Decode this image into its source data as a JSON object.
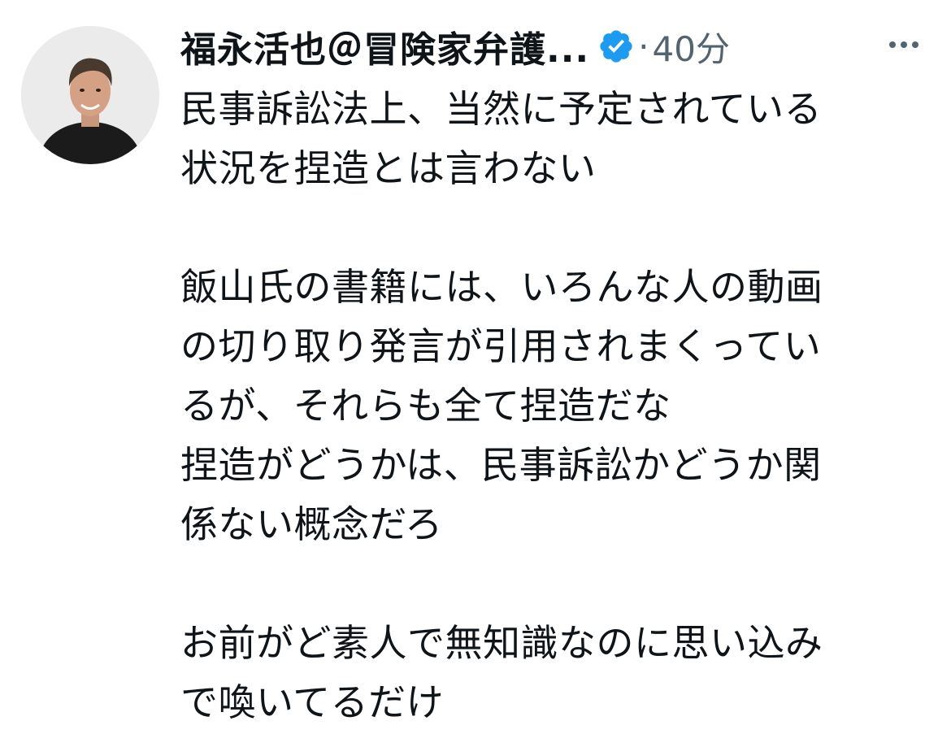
{
  "tweet": {
    "author": {
      "display_name": "福永活也＠冒険家弁護...",
      "verified_icon": "verified-badge-icon",
      "avatar": "avatar-photo"
    },
    "separator": "·",
    "time": "40分",
    "more_icon": "more-options-icon",
    "colors": {
      "text": "#0f1419",
      "muted": "#536471",
      "verified": "#1d9bf0"
    },
    "paragraphs": [
      {
        "lines": [
          "民事訴訟法上、当然に予定されている",
          "状況を捏造とは言わない"
        ]
      },
      {
        "lines": [
          "飯山氏の書籍には、いろんな人の動画",
          "の切り取り発言が引用されまくってい",
          "るが、それらも全て捏造だな",
          "捏造がどうかは、民事訴訟かどうか関",
          "係ない概念だろ"
        ]
      },
      {
        "lines": [
          "お前がど素人で無知識なのに思い込み",
          "で喚いてるだけ"
        ]
      }
    ]
  }
}
